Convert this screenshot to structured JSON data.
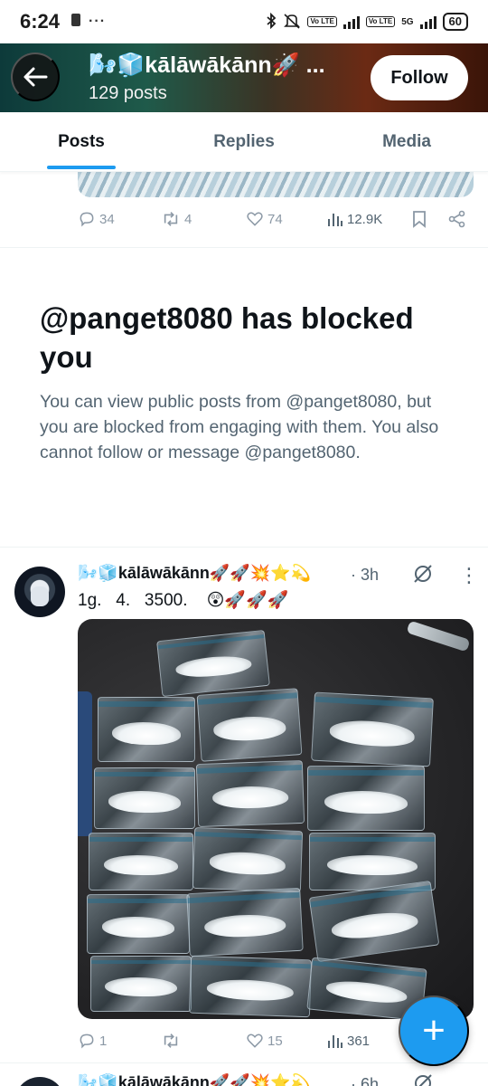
{
  "status_bar": {
    "time": "6:24",
    "left_icons": [
      "notification-icon",
      "more-dots-icon"
    ],
    "right_icons": [
      "bluetooth-icon",
      "mute-icon",
      "volte-icon",
      "signal-icon",
      "5g-icon",
      "signal-icon"
    ],
    "lte_label": "Vo LTE",
    "network": "5G",
    "battery": "60"
  },
  "header": {
    "back_icon": "back-arrow-icon",
    "name": "🌬️🧊kālāwākānn🚀 ...",
    "posts_count": "129 posts",
    "follow_label": "Follow"
  },
  "tabs": [
    {
      "label": "Posts",
      "active": true
    },
    {
      "label": "Replies",
      "active": false
    },
    {
      "label": "Media",
      "active": false
    }
  ],
  "top_post": {
    "replies": "34",
    "reposts": "4",
    "likes": "74",
    "views": "12.9K"
  },
  "blocked_notice": {
    "title": "@panget8080 has blocked you",
    "description": "You can view public posts from @panget8080, but you are blocked from engaging with them. You also cannot follow or message @panget8080."
  },
  "post": {
    "display_name": "🌬️🧊kālāwākānn🚀🚀💥⭐💫",
    "time": "· 3h",
    "text": "1g.   4.   3500.    😲🚀🚀🚀",
    "replies": "1",
    "reposts": "",
    "likes": "15",
    "views": "361"
  },
  "next_post": {
    "display_name": "🌬️🧊kālāwākānn🚀🚀💥⭐💫",
    "time": "· 6h"
  },
  "fab_label": "+",
  "colors": {
    "accent": "#1d9bf0",
    "text_primary": "#0f1419",
    "text_secondary": "#536471",
    "icon_gray": "#8b98a5"
  }
}
